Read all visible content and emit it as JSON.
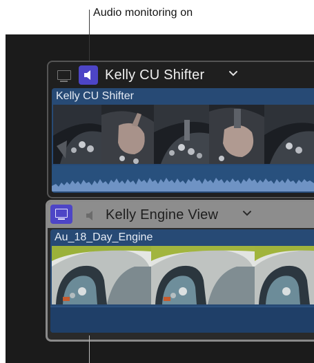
{
  "callout": {
    "label": "Audio monitoring on"
  },
  "angles": [
    {
      "name": "Kelly CU Shifter",
      "clip_name": "Kelly CU Shifter",
      "video_monitoring": false,
      "audio_monitoring": true
    },
    {
      "name": "Kelly Engine View",
      "clip_name": "Au_18_Day_Engine",
      "video_monitoring": true,
      "audio_monitoring": false
    }
  ],
  "colors": {
    "accent": "#4d45c6",
    "clip_blue": "#274a75",
    "waveform": "#6f93c4",
    "panel": "#1b1b1b"
  },
  "icons": [
    "monitor-icon",
    "speaker-icon",
    "chevron-down-icon"
  ]
}
